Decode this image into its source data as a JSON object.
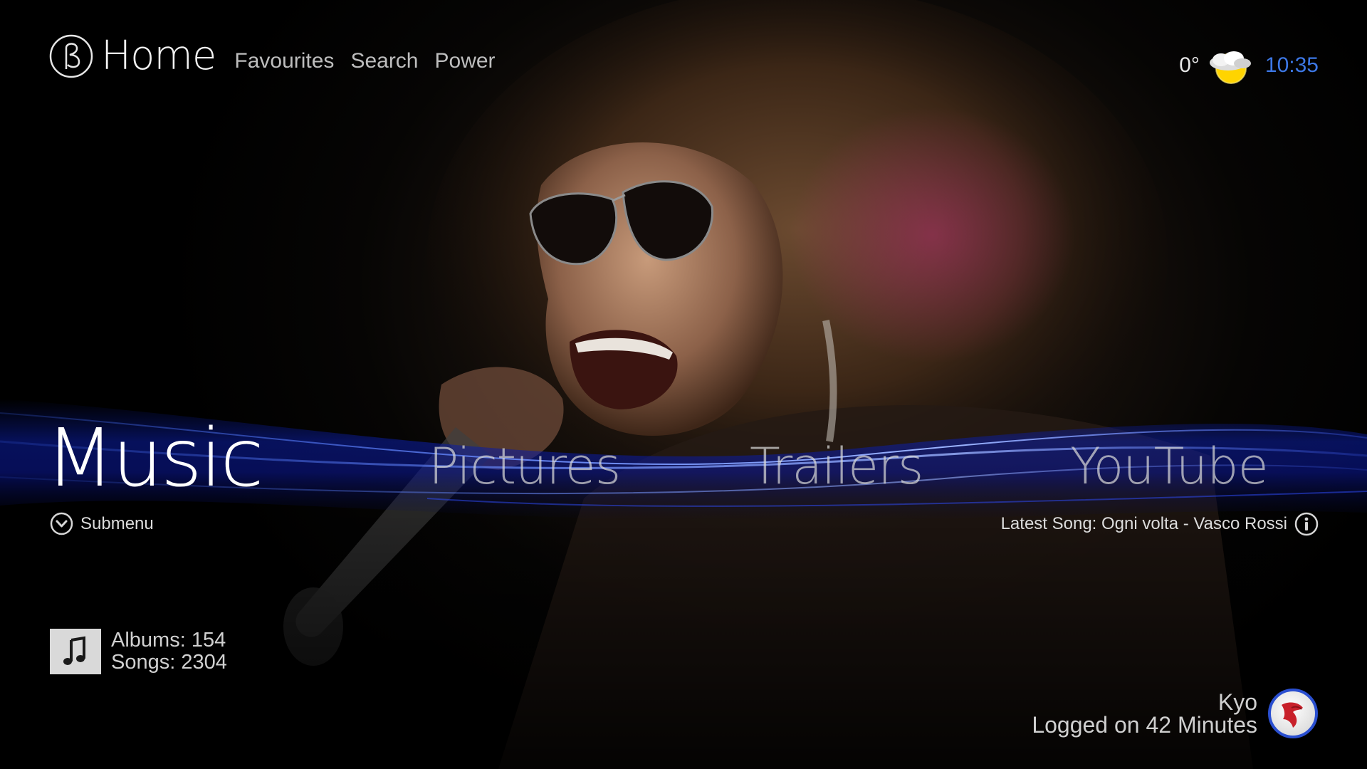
{
  "header": {
    "title": "Home",
    "links": [
      "Favourites",
      "Search",
      "Power"
    ]
  },
  "status": {
    "temperature": "0°",
    "weather_icon": "partly-cloudy-icon",
    "time": "10:35"
  },
  "menu": {
    "active": "Music",
    "items": [
      "Pictures",
      "Trailers",
      "YouTube"
    ]
  },
  "submenu_label": "Submenu",
  "latest_song": "Latest Song: Ogni volta - Vasco Rossi",
  "stats": {
    "albums": "Albums: 154",
    "songs": "Songs: 2304"
  },
  "user": {
    "name": "Kyo",
    "logged": "Logged on 42 Minutes"
  },
  "colors": {
    "accent": "#3d78e6",
    "wave": "#1a3cff"
  }
}
